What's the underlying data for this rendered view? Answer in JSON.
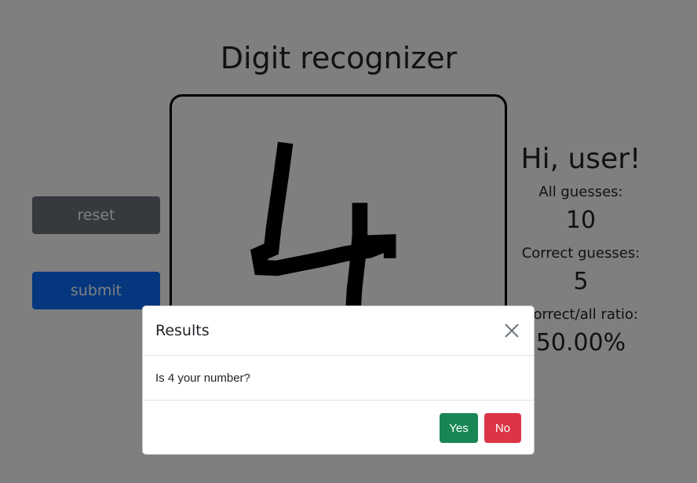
{
  "header": {
    "title": "Digit recognizer"
  },
  "controls": {
    "reset_label": "reset",
    "submit_label": "submit"
  },
  "canvas": {
    "drawn_digit_icon": "handwritten-digit-4"
  },
  "stats": {
    "greeting": "Hi, user!",
    "all_guesses_label": "All guesses:",
    "all_guesses_value": "10",
    "correct_guesses_label": "Correct guesses:",
    "correct_guesses_value": "5",
    "ratio_label": "Correct/all ratio:",
    "ratio_value": "50.00%"
  },
  "modal": {
    "title": "Results",
    "question": "Is 4 your number?",
    "yes_label": "Yes",
    "no_label": "No",
    "close_icon": "close-icon"
  },
  "colors": {
    "secondary": "#6c757d",
    "primary": "#0d6efd",
    "success": "#198754",
    "danger": "#dc3545",
    "backdrop": "rgba(0,0,0,0.5)"
  }
}
